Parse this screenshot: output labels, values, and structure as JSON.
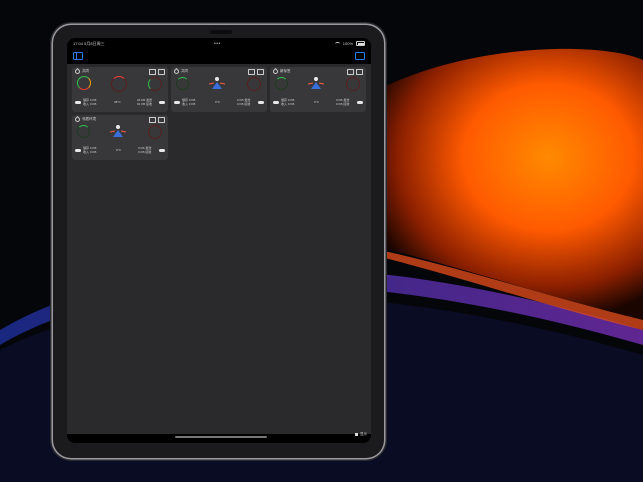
{
  "status_bar": {
    "time": "17:04",
    "date": "5月8日周三",
    "battery": "100%"
  },
  "colors": {
    "accent": "#2e7cf6",
    "ring_green": "#2ec24a",
    "ring_red": "#ff3b30",
    "ring_orange": "#ff9f0a",
    "ring_dark_red": "#5a1e1e",
    "wallpaper_orange": "#ff5a00"
  },
  "cards": [
    {
      "title": "共同",
      "left_stats": [
        "储存 0 KB",
        "收入 0 KB"
      ],
      "temp": "38°C",
      "right_stats": [
        "26 KB 发送",
        "91 KB 接收"
      ]
    },
    {
      "title": "共同",
      "left_stats": [
        "储存 0 KB",
        "收入 0 KB"
      ],
      "temp": "0°C",
      "right_stats": [
        "0 KB 发送",
        "0 KB 接收"
      ]
    },
    {
      "title": "新标签",
      "left_stats": [
        "储存 0 KB",
        "收入 0 KB"
      ],
      "temp": "0°C",
      "right_stats": [
        "0 KB 发送",
        "0 KB 接收"
      ]
    },
    {
      "title": "邻居环境",
      "left_stats": [
        "储存 0 KB",
        "收入 0 KB"
      ],
      "temp": "0°C",
      "right_stats": [
        "0 KB 发送",
        "0 KB 接收"
      ]
    }
  ],
  "bottom": {
    "label": "显示"
  }
}
